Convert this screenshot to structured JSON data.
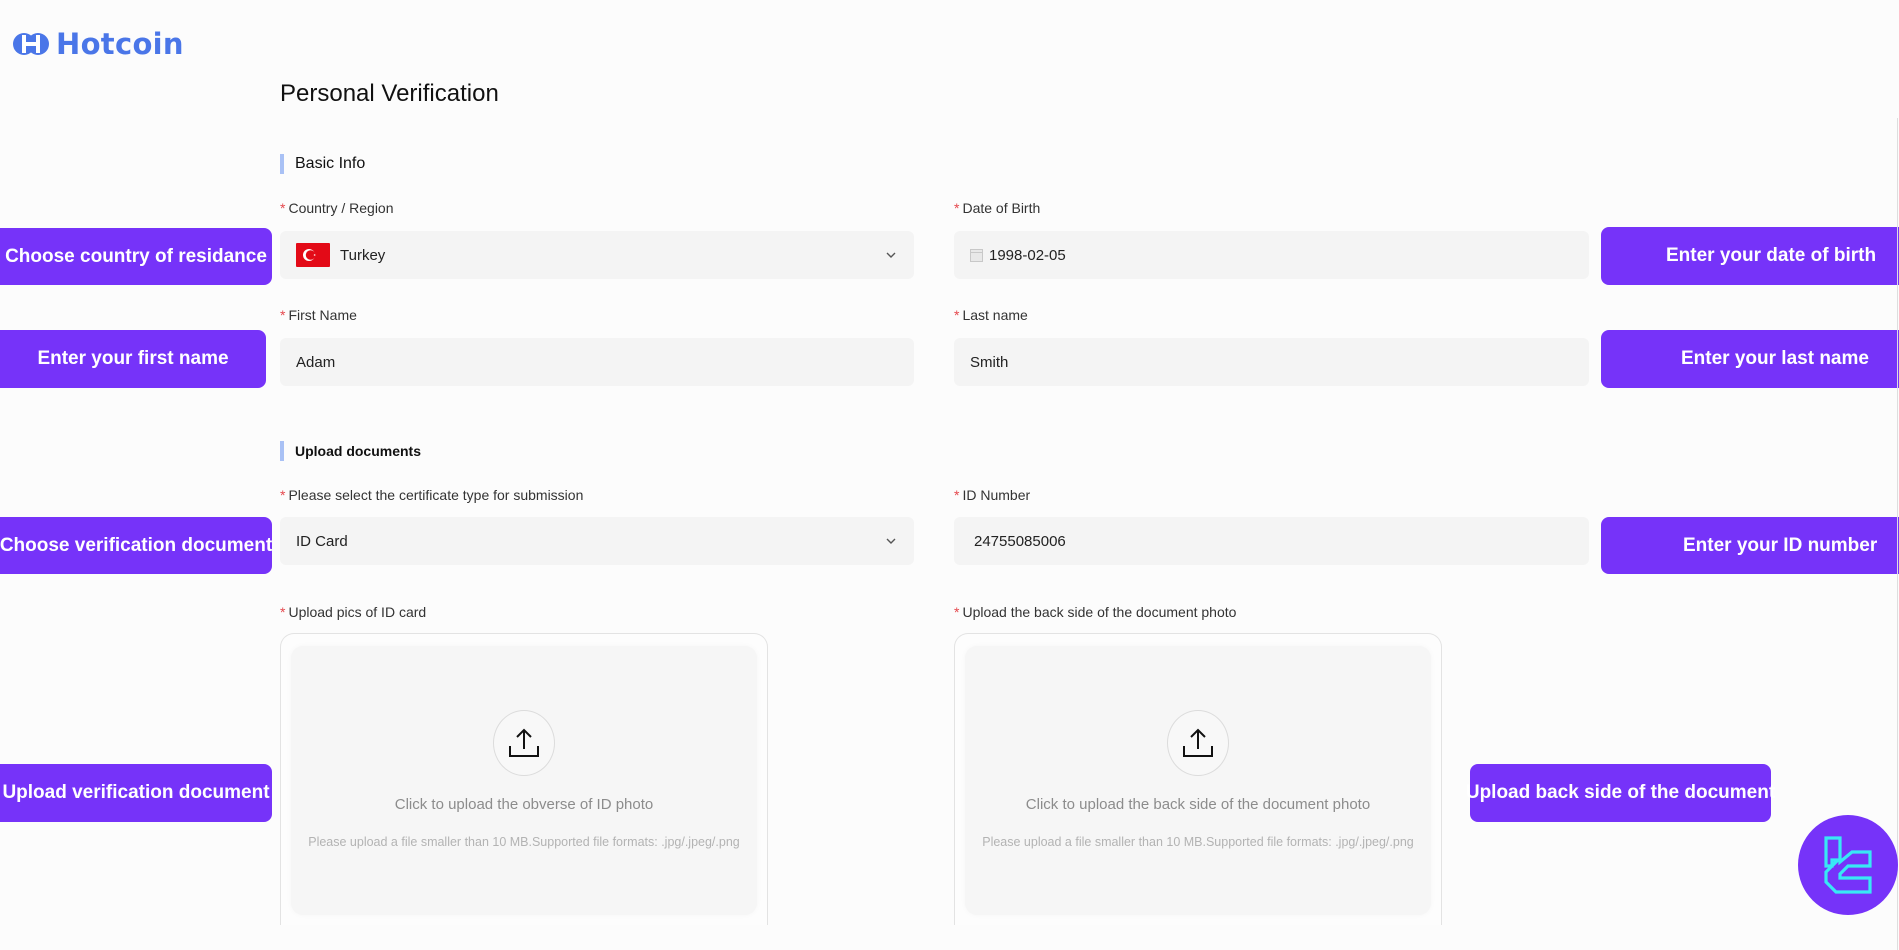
{
  "brand": {
    "name": "Hotcoin",
    "color": "#4a76e8"
  },
  "page": {
    "title": "Personal Verification"
  },
  "sections": {
    "basic_info": {
      "label": "Basic Info"
    },
    "upload_documents": {
      "label": "Upload documents"
    }
  },
  "fields": {
    "country": {
      "label": "Country / Region",
      "value": "Turkey",
      "flag": "turkey-flag"
    },
    "dob": {
      "label": "Date of Birth",
      "value": "1998-02-05"
    },
    "first_name": {
      "label": "First Name",
      "value": "Adam"
    },
    "last_name": {
      "label": "Last name",
      "value": "Smith"
    },
    "certificate_type": {
      "label": "Please select the certificate type for submission",
      "value": "ID Card"
    },
    "id_number": {
      "label": "ID Number",
      "value": "24755085006"
    },
    "upload_front": {
      "label": "Upload pics of ID card",
      "title": "Click to upload the obverse of ID photo",
      "hint": "Please upload a file smaller than 10 MB.Supported file formats: .jpg/.jpeg/.png"
    },
    "upload_back": {
      "label": "Upload the back side of the document photo",
      "title": "Click to upload the back side of the document photo",
      "hint": "Please upload a file smaller than 10 MB.Supported file formats: .jpg/.jpeg/.png"
    }
  },
  "required_marker": "*",
  "callouts": {
    "country": "Choose country of residance",
    "first_name": "Enter your first name",
    "document": "Choose verification document",
    "upload": "Upload verification document",
    "dob": "Enter your date of birth",
    "last_name": "Enter your last name",
    "id_number": "Enter your ID number",
    "upload_back": "Upload back side of the document"
  },
  "colors": {
    "callout": "#7633f9",
    "required": "#e5484d",
    "section_bar": "#a9c1f5"
  }
}
